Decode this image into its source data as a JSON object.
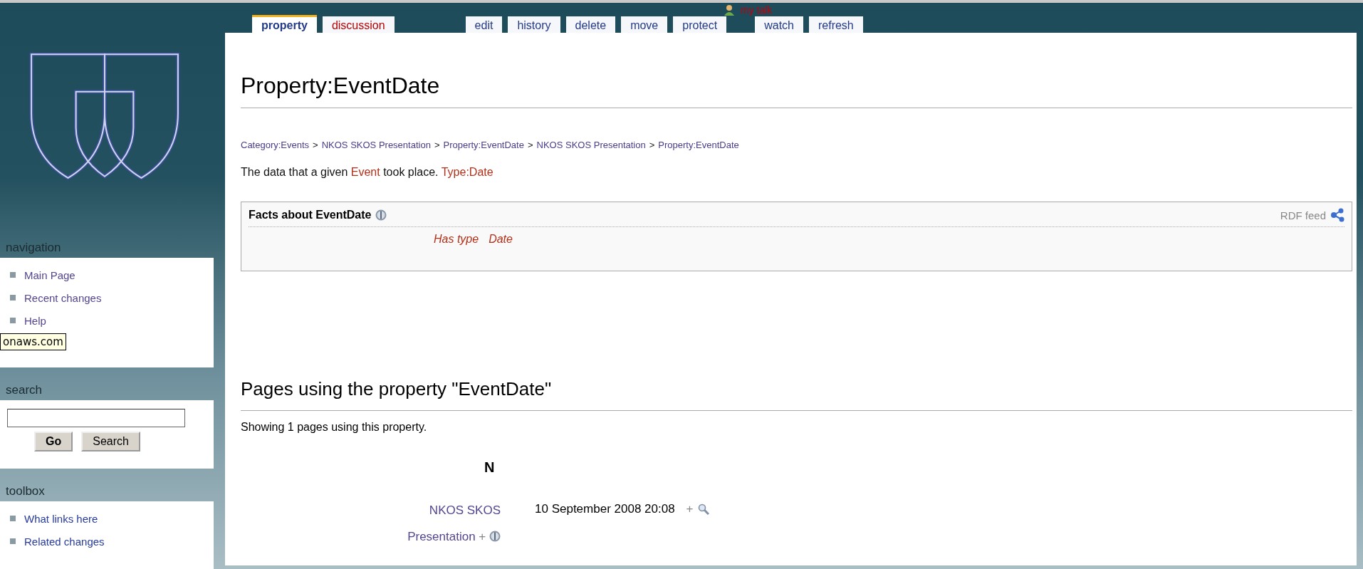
{
  "personal_links": [
    {
      "label": "my talk",
      "exists": false
    }
  ],
  "tabs": [
    {
      "label": "property",
      "selected": true,
      "exists": true,
      "kind": "namespace"
    },
    {
      "label": "discussion",
      "selected": false,
      "exists": false,
      "kind": "namespace"
    },
    {
      "label": "edit",
      "selected": false,
      "exists": true,
      "kind": "action"
    },
    {
      "label": "history",
      "selected": false,
      "exists": true,
      "kind": "action"
    },
    {
      "label": "delete",
      "selected": false,
      "exists": true,
      "kind": "action"
    },
    {
      "label": "move",
      "selected": false,
      "exists": true,
      "kind": "action"
    },
    {
      "label": "protect",
      "selected": false,
      "exists": true,
      "kind": "action"
    },
    {
      "label": "watch",
      "selected": false,
      "exists": true,
      "kind": "extra"
    },
    {
      "label": "refresh",
      "selected": false,
      "exists": true,
      "kind": "extra"
    }
  ],
  "sidebar": {
    "navigation": {
      "title": "navigation",
      "items": [
        "Main Page",
        "Recent changes",
        "Help"
      ]
    },
    "search": {
      "title": "search",
      "buttons": [
        {
          "label": "Go",
          "kind": "primary"
        },
        {
          "label": "Search",
          "kind": "secondary"
        }
      ]
    },
    "toolbox": {
      "title": "toolbox",
      "items": [
        "What links here",
        "Related changes"
      ]
    }
  },
  "tooltip": "onaws.com",
  "content": {
    "title": "Property:EventDate",
    "breadcrumbs": [
      "Category:Events",
      "NKOS SKOS Presentation",
      "Property:EventDate",
      "NKOS SKOS Presentation",
      "Property:EventDate"
    ],
    "separator": ">",
    "description": [
      {
        "text": "The data that a given ",
        "kind": "text"
      },
      {
        "text": "Event",
        "kind": "link"
      },
      {
        "text": " took place. ",
        "kind": "text"
      },
      {
        "text": "Type:Date",
        "kind": "link"
      }
    ],
    "facts": {
      "title": "Facts about EventDate",
      "feed": "RDF feed",
      "rows": [
        {
          "property": "Has type",
          "value": "Date"
        }
      ]
    },
    "section": {
      "heading": "Pages using the property \"EventDate\"",
      "summary": "Showing 1 pages using this property.",
      "letter": "N",
      "rows": [
        {
          "page_line_1": "NKOS SKOS",
          "page_line_2": "Presentation",
          "browse": "+",
          "value": "10 September 2008 20:08",
          "search": "+"
        }
      ]
    }
  }
}
